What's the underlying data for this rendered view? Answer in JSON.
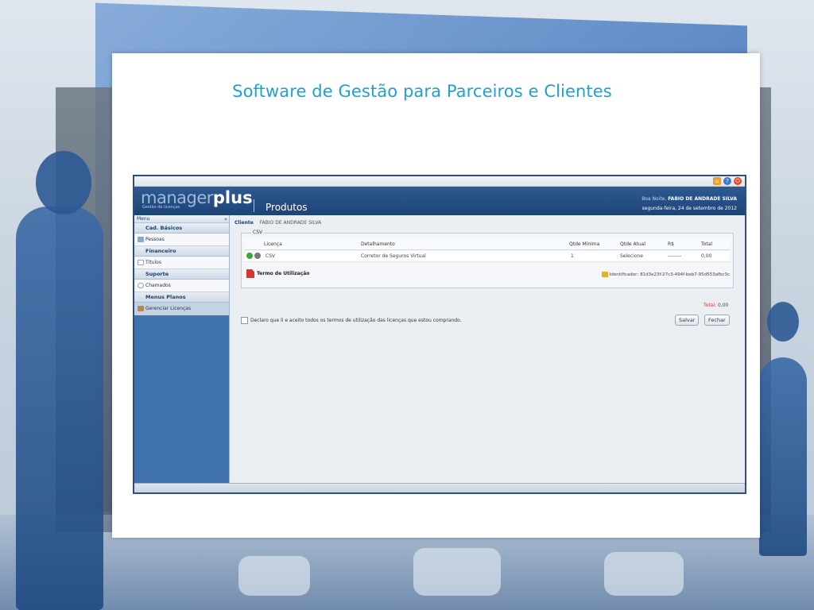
{
  "slide": {
    "title": "Software de Gestão para Parceiros e Clientes"
  },
  "app": {
    "logo": {
      "manager": "manager",
      "plus": "plus",
      "subtitle": "Gestão de licenças"
    },
    "page_title": "Produtos",
    "greeting_prefix": "Boa Noite,",
    "user_name": "FABIO DE ANDRADE SILVA",
    "date": "segunda-feira, 24 de setembro de 2012",
    "top_icons": [
      "home-icon",
      "help-icon",
      "power-icon"
    ],
    "sidebar": {
      "menu_label": "Menu",
      "collapse_label": "«",
      "sections": [
        {
          "title": "Cad. Básicos",
          "items": [
            "Pessoas"
          ]
        },
        {
          "title": "Financeiro",
          "items": [
            "Títulos"
          ]
        },
        {
          "title": "Suporte",
          "items": [
            "Chamados"
          ]
        },
        {
          "title": "Menus Planos",
          "items": [
            "Gerenciar Licenças"
          ]
        }
      ]
    },
    "main": {
      "client_label": "Cliente",
      "client_name": "FABIO DE ANDRADE SILVA",
      "group_label": "CSV",
      "columns": [
        "Licença",
        "Detalhamento",
        "Qtde Mínima",
        "Qtde Atual",
        "R$",
        "Total"
      ],
      "rows": [
        {
          "licenca": "CSV",
          "detalhamento": "Corretor de Seguros Virtual",
          "qtde_minima": "1",
          "qtde_atual": "Selecione",
          "rs": "--------",
          "total": "0,00"
        }
      ],
      "terms_label": "Termo de Utilização",
      "identifier_label": "Identificador:",
      "identifier_value": "81d3e23f-27c3-494f-beb7-95d553afbc3c",
      "total_label": "Total:",
      "total_value": "0,00",
      "declare_text": "Declaro que li e aceito todos os termos de utilização das licenças que estou comprando.",
      "save_label": "Salvar",
      "close_label": "Fechar"
    }
  }
}
